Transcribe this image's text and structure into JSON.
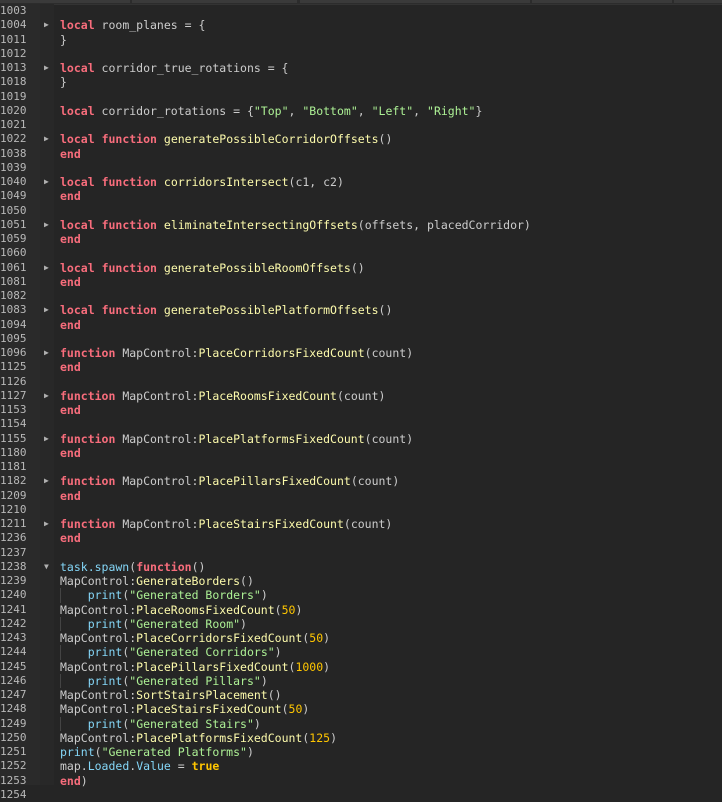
{
  "colors": {
    "background": "#252525",
    "keyword": "#f86d7c",
    "function_name": "#fdfbac",
    "builtin": "#84d6f7",
    "string": "#adf195",
    "number": "#ffc600"
  },
  "lines": [
    {
      "n": "1003",
      "t": []
    },
    {
      "n": "1004",
      "fold": "collapsed",
      "t": [
        [
          "kw",
          "local"
        ],
        [
          "id",
          " room_planes = {"
        ]
      ]
    },
    {
      "n": "1011",
      "t": [
        [
          "id",
          "}"
        ]
      ]
    },
    {
      "n": "1012",
      "t": []
    },
    {
      "n": "1013",
      "fold": "collapsed",
      "t": [
        [
          "kw",
          "local"
        ],
        [
          "id",
          " corridor_true_rotations = {"
        ]
      ]
    },
    {
      "n": "1018",
      "t": [
        [
          "id",
          "}"
        ]
      ]
    },
    {
      "n": "1019",
      "t": []
    },
    {
      "n": "1020",
      "t": [
        [
          "kw",
          "local"
        ],
        [
          "id",
          " corridor_rotations = {"
        ],
        [
          "str",
          "\"Top\""
        ],
        [
          "id",
          ", "
        ],
        [
          "str",
          "\"Bottom\""
        ],
        [
          "id",
          ", "
        ],
        [
          "str",
          "\"Left\""
        ],
        [
          "id",
          ", "
        ],
        [
          "str",
          "\"Right\""
        ],
        [
          "id",
          "}"
        ]
      ]
    },
    {
      "n": "1021",
      "t": []
    },
    {
      "n": "1022",
      "fold": "collapsed",
      "t": [
        [
          "kw",
          "local"
        ],
        [
          "id",
          " "
        ],
        [
          "kw",
          "function"
        ],
        [
          "id",
          " "
        ],
        [
          "fn",
          "generatePossibleCorridorOffsets"
        ],
        [
          "id",
          "()"
        ]
      ]
    },
    {
      "n": "1038",
      "t": [
        [
          "kw",
          "end"
        ]
      ]
    },
    {
      "n": "1039",
      "t": []
    },
    {
      "n": "1040",
      "fold": "collapsed",
      "t": [
        [
          "kw",
          "local"
        ],
        [
          "id",
          " "
        ],
        [
          "kw",
          "function"
        ],
        [
          "id",
          " "
        ],
        [
          "fn",
          "corridorsIntersect"
        ],
        [
          "id",
          "(c1, c2)"
        ]
      ]
    },
    {
      "n": "1049",
      "t": [
        [
          "kw",
          "end"
        ]
      ]
    },
    {
      "n": "1050",
      "t": []
    },
    {
      "n": "1051",
      "fold": "collapsed",
      "t": [
        [
          "kw",
          "local"
        ],
        [
          "id",
          " "
        ],
        [
          "kw",
          "function"
        ],
        [
          "id",
          " "
        ],
        [
          "fn",
          "eliminateIntersectingOffsets"
        ],
        [
          "id",
          "(offsets, placedCorridor)"
        ]
      ]
    },
    {
      "n": "1059",
      "t": [
        [
          "kw",
          "end"
        ]
      ]
    },
    {
      "n": "1060",
      "t": []
    },
    {
      "n": "1061",
      "fold": "collapsed",
      "t": [
        [
          "kw",
          "local"
        ],
        [
          "id",
          " "
        ],
        [
          "kw",
          "function"
        ],
        [
          "id",
          " "
        ],
        [
          "fn",
          "generatePossibleRoomOffsets"
        ],
        [
          "id",
          "()"
        ]
      ]
    },
    {
      "n": "1081",
      "t": [
        [
          "kw",
          "end"
        ]
      ]
    },
    {
      "n": "1082",
      "t": []
    },
    {
      "n": "1083",
      "fold": "collapsed",
      "t": [
        [
          "kw",
          "local"
        ],
        [
          "id",
          " "
        ],
        [
          "kw",
          "function"
        ],
        [
          "id",
          " "
        ],
        [
          "fn",
          "generatePossiblePlatformOffsets"
        ],
        [
          "id",
          "()"
        ]
      ]
    },
    {
      "n": "1094",
      "t": [
        [
          "kw",
          "end"
        ]
      ]
    },
    {
      "n": "1095",
      "t": []
    },
    {
      "n": "1096",
      "fold": "collapsed",
      "t": [
        [
          "kw",
          "function"
        ],
        [
          "id",
          " MapControl:"
        ],
        [
          "fn",
          "PlaceCorridorsFixedCount"
        ],
        [
          "id",
          "(count)"
        ]
      ]
    },
    {
      "n": "1125",
      "t": [
        [
          "kw",
          "end"
        ]
      ]
    },
    {
      "n": "1126",
      "t": []
    },
    {
      "n": "1127",
      "fold": "collapsed",
      "t": [
        [
          "kw",
          "function"
        ],
        [
          "id",
          " MapControl:"
        ],
        [
          "fn",
          "PlaceRoomsFixedCount"
        ],
        [
          "id",
          "(count)"
        ]
      ]
    },
    {
      "n": "1153",
      "t": [
        [
          "kw",
          "end"
        ]
      ]
    },
    {
      "n": "1154",
      "t": []
    },
    {
      "n": "1155",
      "fold": "collapsed",
      "t": [
        [
          "kw",
          "function"
        ],
        [
          "id",
          " MapControl:"
        ],
        [
          "fn",
          "PlacePlatformsFixedCount"
        ],
        [
          "id",
          "(count)"
        ]
      ]
    },
    {
      "n": "1180",
      "t": [
        [
          "kw",
          "end"
        ]
      ]
    },
    {
      "n": "1181",
      "t": []
    },
    {
      "n": "1182",
      "fold": "collapsed",
      "t": [
        [
          "kw",
          "function"
        ],
        [
          "id",
          " MapControl:"
        ],
        [
          "fn",
          "PlacePillarsFixedCount"
        ],
        [
          "id",
          "(count)"
        ]
      ]
    },
    {
      "n": "1209",
      "t": [
        [
          "kw",
          "end"
        ]
      ]
    },
    {
      "n": "1210",
      "t": []
    },
    {
      "n": "1211",
      "fold": "collapsed",
      "t": [
        [
          "kw",
          "function"
        ],
        [
          "id",
          " MapControl:"
        ],
        [
          "fn",
          "PlaceStairsFixedCount"
        ],
        [
          "id",
          "(count)"
        ]
      ]
    },
    {
      "n": "1236",
      "t": [
        [
          "kw",
          "end"
        ]
      ]
    },
    {
      "n": "1237",
      "t": []
    },
    {
      "n": "1238",
      "fold": "expanded",
      "t": [
        [
          "bi",
          "task.spawn"
        ],
        [
          "id",
          "("
        ],
        [
          "kw",
          "function"
        ],
        [
          "id",
          "()"
        ]
      ]
    },
    {
      "n": "1239",
      "t": [
        [
          "id",
          "MapControl:"
        ],
        [
          "fn",
          "GenerateBorders"
        ],
        [
          "id",
          "()"
        ]
      ]
    },
    {
      "n": "1240",
      "guide": true,
      "t": [
        [
          "id",
          "    "
        ],
        [
          "bi",
          "print"
        ],
        [
          "id",
          "("
        ],
        [
          "str",
          "\"Generated Borders\""
        ],
        [
          "id",
          ")"
        ]
      ]
    },
    {
      "n": "1241",
      "t": [
        [
          "id",
          "MapControl:"
        ],
        [
          "fn",
          "PlaceRoomsFixedCount"
        ],
        [
          "id",
          "("
        ],
        [
          "num",
          "50"
        ],
        [
          "id",
          ")"
        ]
      ]
    },
    {
      "n": "1242",
      "guide": true,
      "t": [
        [
          "id",
          "    "
        ],
        [
          "bi",
          "print"
        ],
        [
          "id",
          "("
        ],
        [
          "str",
          "\"Generated Room\""
        ],
        [
          "id",
          ")"
        ]
      ]
    },
    {
      "n": "1243",
      "t": [
        [
          "id",
          "MapControl:"
        ],
        [
          "fn",
          "PlaceCorridorsFixedCount"
        ],
        [
          "id",
          "("
        ],
        [
          "num",
          "50"
        ],
        [
          "id",
          ")"
        ]
      ]
    },
    {
      "n": "1244",
      "guide": true,
      "t": [
        [
          "id",
          "    "
        ],
        [
          "bi",
          "print"
        ],
        [
          "id",
          "("
        ],
        [
          "str",
          "\"Generated Corridors\""
        ],
        [
          "id",
          ")"
        ]
      ]
    },
    {
      "n": "1245",
      "t": [
        [
          "id",
          "MapControl:"
        ],
        [
          "fn",
          "PlacePillarsFixedCount"
        ],
        [
          "id",
          "("
        ],
        [
          "num",
          "1000"
        ],
        [
          "id",
          ")"
        ]
      ]
    },
    {
      "n": "1246",
      "guide": true,
      "t": [
        [
          "id",
          "    "
        ],
        [
          "bi",
          "print"
        ],
        [
          "id",
          "("
        ],
        [
          "str",
          "\"Generated Pillars\""
        ],
        [
          "id",
          ")"
        ]
      ]
    },
    {
      "n": "1247",
      "t": [
        [
          "id",
          "MapControl:"
        ],
        [
          "fn",
          "SortStairsPlacement"
        ],
        [
          "id",
          "()"
        ]
      ]
    },
    {
      "n": "1248",
      "t": [
        [
          "id",
          "MapControl:"
        ],
        [
          "fn",
          "PlaceStairsFixedCount"
        ],
        [
          "id",
          "("
        ],
        [
          "num",
          "50"
        ],
        [
          "id",
          ")"
        ]
      ]
    },
    {
      "n": "1249",
      "guide": true,
      "t": [
        [
          "id",
          "    "
        ],
        [
          "bi",
          "print"
        ],
        [
          "id",
          "("
        ],
        [
          "str",
          "\"Generated Stairs\""
        ],
        [
          "id",
          ")"
        ]
      ]
    },
    {
      "n": "1250",
      "t": [
        [
          "id",
          "MapControl:"
        ],
        [
          "fn",
          "PlacePlatformsFixedCount"
        ],
        [
          "id",
          "("
        ],
        [
          "num",
          "125"
        ],
        [
          "id",
          ")"
        ]
      ]
    },
    {
      "n": "1251",
      "t": [
        [
          "bi",
          "print"
        ],
        [
          "id",
          "("
        ],
        [
          "str",
          "\"Generated Platforms\""
        ],
        [
          "id",
          ")"
        ]
      ]
    },
    {
      "n": "1252",
      "t": [
        [
          "id",
          "map."
        ],
        [
          "bi",
          "Loaded"
        ],
        [
          "id",
          "."
        ],
        [
          "bi",
          "Value"
        ],
        [
          "id",
          " = "
        ],
        [
          "bool",
          "true"
        ]
      ]
    },
    {
      "n": "1253",
      "t": [
        [
          "kw",
          "end"
        ],
        [
          "id",
          ")"
        ]
      ]
    },
    {
      "n": "1254",
      "t": []
    }
  ]
}
